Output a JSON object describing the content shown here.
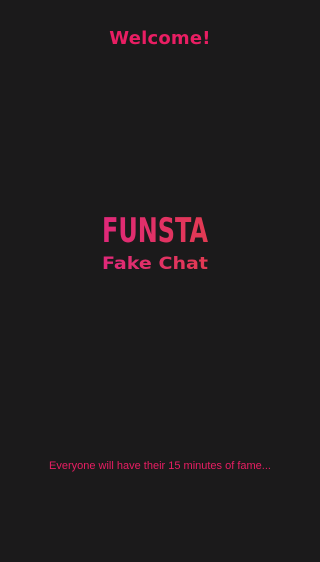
{
  "header": {
    "title": "Welcome!"
  },
  "logo": {
    "brand": "FUNSTA",
    "subtitle": "Fake Chat"
  },
  "footer": {
    "tagline": "Everyone will have their 15 minutes of fame..."
  },
  "colors": {
    "background": "#1b1a1b",
    "accent": "#e91e63",
    "gradient_pink": "#e0287a",
    "gradient_red": "#e23a52"
  }
}
